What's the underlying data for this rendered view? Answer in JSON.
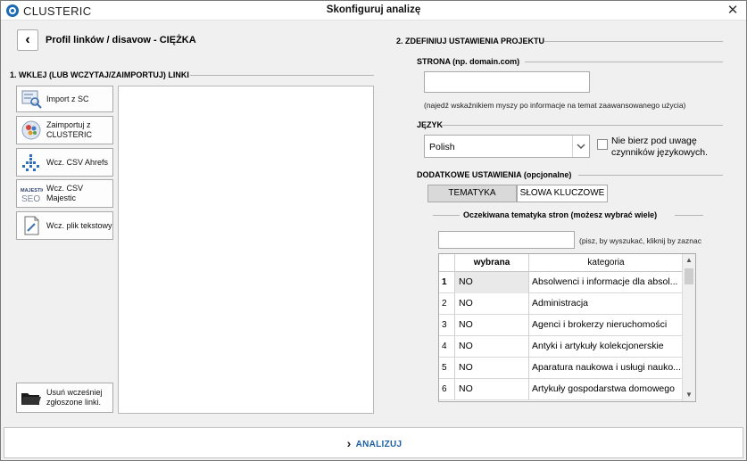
{
  "titlebar": {
    "app_name": "CLUSTERIC",
    "title": "Skonfiguruj analizę",
    "close_glyph": "✕"
  },
  "header": {
    "back_glyph": "‹",
    "profile_title": "Profil linków / disavow - CIĘŻKA"
  },
  "left_section": {
    "label": "1. WKLEJ (LUB WCZYTAJ/ZAIMPORTUJ) LINKI",
    "buttons": [
      {
        "label": "Import z SC",
        "icon": "search-console-icon"
      },
      {
        "label": "Zaimportuj z CLUSTERIC",
        "icon": "clusteric-logo-icon"
      },
      {
        "label": "Wcz. CSV Ahrefs",
        "icon": "ahrefs-dots-icon"
      },
      {
        "label": "Wcz. CSV Majestic",
        "icon": "majestic-seo-icon"
      },
      {
        "label": "Wcz. plik tekstowy",
        "icon": "text-file-icon"
      }
    ],
    "remove_button": "Usuń wcześniej zgłoszone linki."
  },
  "right_section": {
    "label": "2. ZDEFINIUJ USTAWIENIA PROJEKTU",
    "site": {
      "label": "STRONA (np. domain.com)",
      "value": "",
      "hint": "(najedź wskaźnikiem myszy po informacje na temat zaawansowanego użycia)"
    },
    "language": {
      "label": "JĘZYK",
      "selected": "Polish",
      "checkbox_label": "Nie bierz pod uwagę czynników językowych.",
      "checked": false
    },
    "extra": {
      "label": "DODATKOWE USTAWIENIA (opcjonalne)",
      "tabs": [
        "TEMATYKA",
        "SŁOWA KLUCZOWE"
      ],
      "active_tab": 0,
      "topic_label": "Oczekiwana tematyka stron (możesz wybrać wiele)",
      "search_hint": "(pisz, by wyszukać, kliknij by zaznac",
      "search_value": "",
      "columns": [
        "wybrana",
        "kategoria"
      ],
      "rows": [
        {
          "n": "1",
          "selected": "NO",
          "category": "Absolwenci i informacje dla absol..."
        },
        {
          "n": "2",
          "selected": "NO",
          "category": "Administracja"
        },
        {
          "n": "3",
          "selected": "NO",
          "category": "Agenci i brokerzy nieruchomości"
        },
        {
          "n": "4",
          "selected": "NO",
          "category": "Antyki i artykuły kolekcjonerskie"
        },
        {
          "n": "5",
          "selected": "NO",
          "category": "Aparatura naukowa i usługi nauko..."
        },
        {
          "n": "6",
          "selected": "NO",
          "category": "Artykuły gospodarstwa domowego"
        }
      ]
    }
  },
  "footer": {
    "analyze_label": "ANALIZUJ",
    "chevron": "›"
  }
}
